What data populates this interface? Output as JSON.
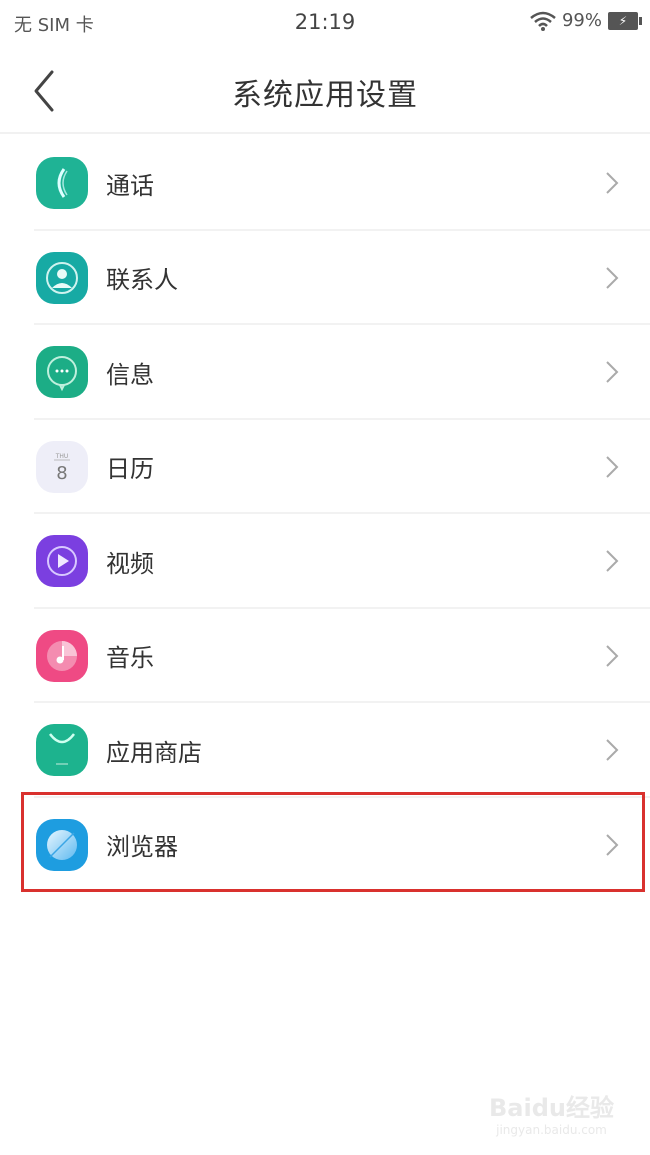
{
  "status_bar": {
    "carrier": "无 SIM 卡",
    "time": "21:19",
    "battery_percent": "99%",
    "battery_icon_text": "⚡"
  },
  "header": {
    "back_icon": "chevron-left-icon",
    "title": "系统应用设置"
  },
  "items": [
    {
      "label": "通话",
      "icon": "phone-icon",
      "color": "#1fb395"
    },
    {
      "label": "联系人",
      "icon": "contacts-icon",
      "color": "#17aaa4"
    },
    {
      "label": "信息",
      "icon": "message-icon",
      "color": "#1cad86"
    },
    {
      "label": "日历",
      "icon": "calendar-icon",
      "color": "#eeeef8",
      "day": "8"
    },
    {
      "label": "视频",
      "icon": "video-icon",
      "color": "#7b3fe0"
    },
    {
      "label": "音乐",
      "icon": "music-icon",
      "color": "#ef4a84"
    },
    {
      "label": "应用商店",
      "icon": "app-store-icon",
      "color": "#1db38e"
    },
    {
      "label": "浏览器",
      "icon": "browser-icon",
      "color": "#1e9de0",
      "highlighted": true
    }
  ],
  "highlight_color": "#d9312e",
  "watermark": {
    "line1": "Baidu经验",
    "line2": "jingyan.baidu.com"
  }
}
